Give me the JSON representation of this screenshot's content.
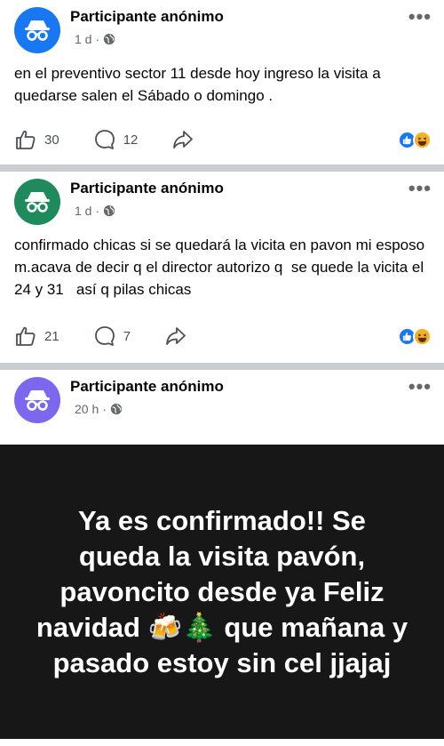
{
  "posts": [
    {
      "author": "Participante anónimo",
      "time": "1 d",
      "avatar_color": "#1877f2",
      "text": "en el preventivo sector 11 desde hoy ingreso la visita a quedarse salen el Sábado o domingo .",
      "likes": "30",
      "comments": "12"
    },
    {
      "author": "Participante anónimo",
      "time": "1 d",
      "avatar_color": "#1f8a5b",
      "text": "confirmado chicas si se quedará la vicita en pavon mi esposo m.acava de decir q el director autorizo q  se quede la vicita el 24 y 31   así q pilas chicas",
      "likes": "21",
      "comments": "7"
    },
    {
      "author": "Participante anónimo",
      "time": "20 h",
      "avatar_color": "#7b68ee",
      "text": "Ya es confirmado!! Se queda la visita pavón, pavoncito desde ya Feliz navidad 🍻🎄 que mañana y pasado estoy sin cel jjajaj",
      "background_color": "#171717"
    }
  ],
  "icons": {
    "avatar": "incognito-icon",
    "privacy": "globe-icon",
    "more": "more-options-icon",
    "like": "thumbs-up-icon",
    "comment": "comment-icon",
    "share": "share-icon",
    "reaction_like": "like-reaction-icon",
    "reaction_haha": "haha-reaction-icon"
  },
  "separator": " · "
}
